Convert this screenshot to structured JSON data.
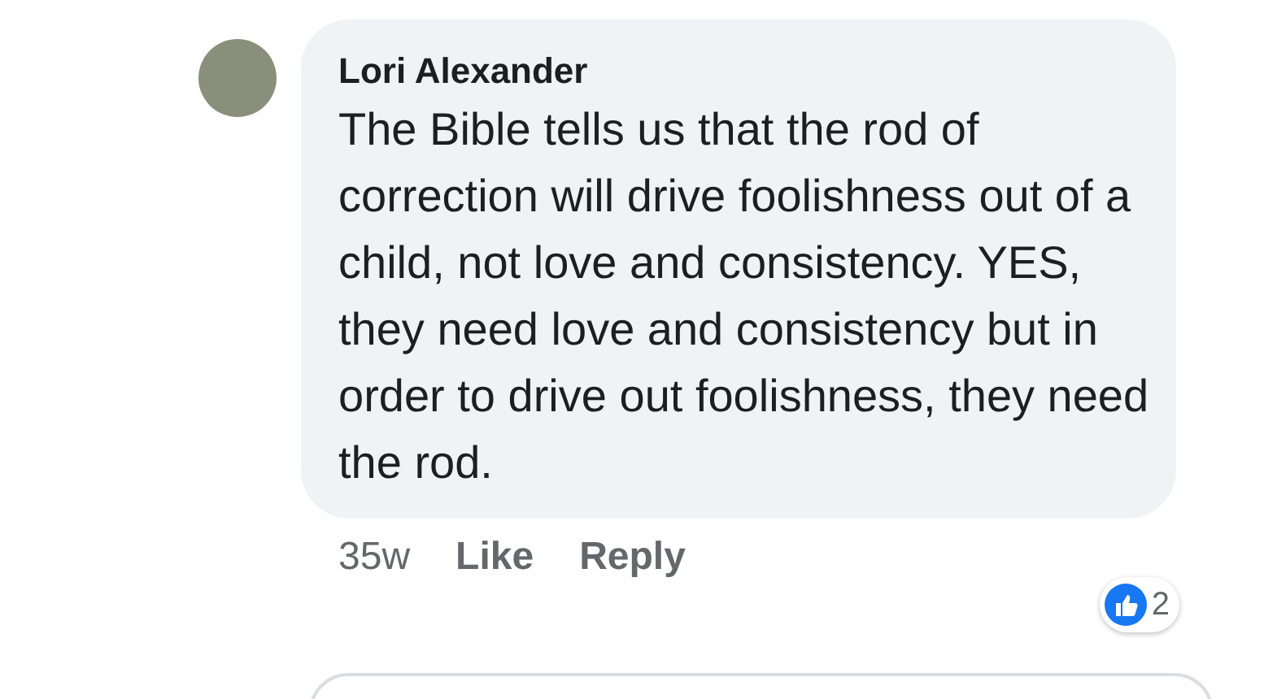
{
  "comment": {
    "author": "Lori Alexander",
    "text": "The Bible tells us that the rod of correction will drive foolishness out of a child, not love and consistency. YES, they need love and consistency but in order to drive out foolishness, they need the rod.",
    "time": "35w",
    "actions": [
      "Like",
      "Reply"
    ],
    "reactions": {
      "count": "2"
    }
  }
}
